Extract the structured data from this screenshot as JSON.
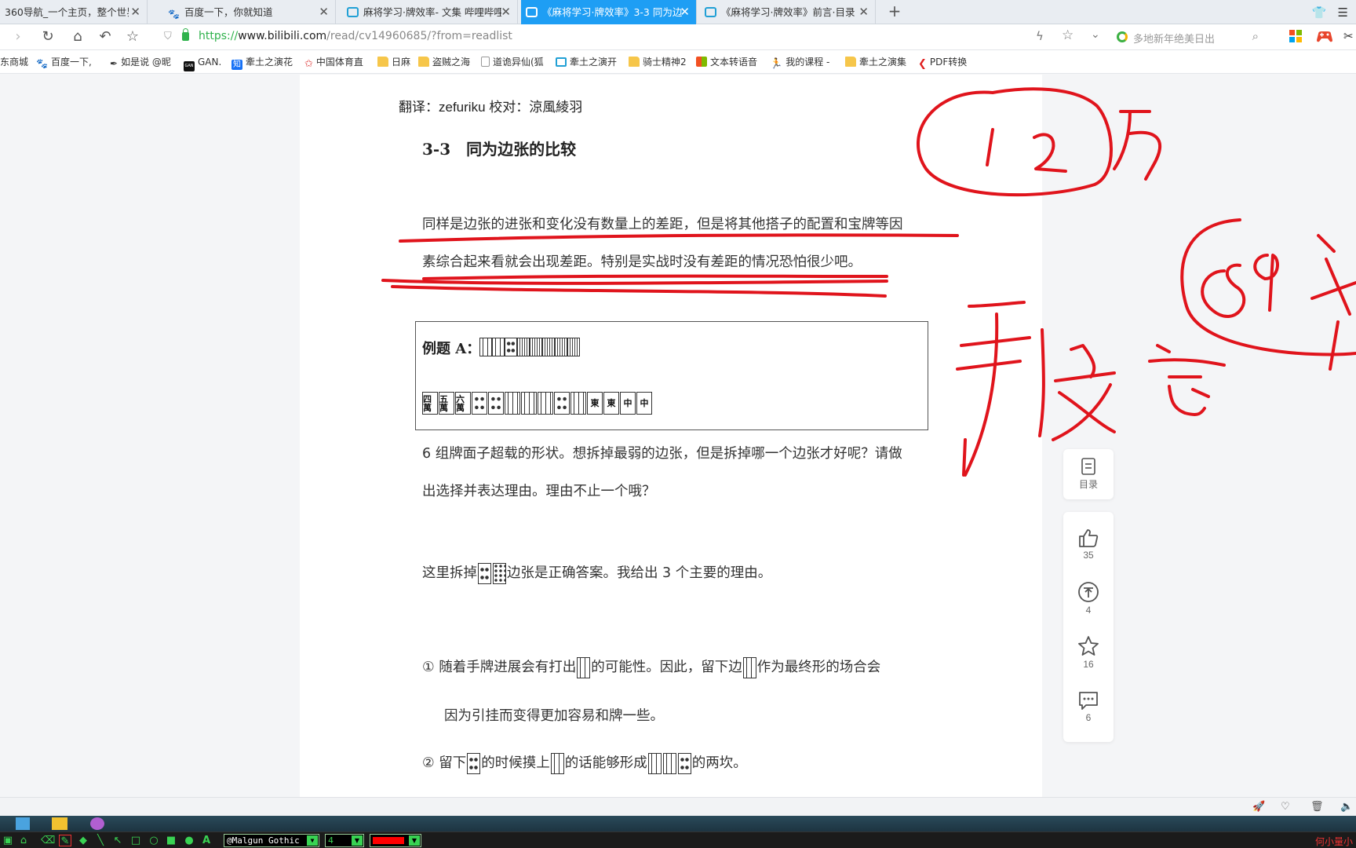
{
  "browser": {
    "tabs": [
      {
        "label": "360导航_一个主页，整个世界",
        "icon": "globe-icon"
      },
      {
        "label": "百度一下，你就知道",
        "icon": "baidu-paw-icon"
      },
      {
        "label": "麻将学习·牌效率- 文集 哔哩哔哩",
        "icon": "bilibili-tv-icon"
      },
      {
        "label": "《麻将学习·牌效率》3-3 同为边",
        "icon": "bilibili-tv-icon"
      },
      {
        "label": "《麻将学习·牌效率》前言·目录",
        "icon": "bilibili-tv-icon"
      }
    ],
    "active_tab": 3,
    "new_tab": "+",
    "url": {
      "protocol": "https://",
      "host": "www.bilibili.com",
      "path": "/read/cv14960685/?from=readlist"
    },
    "search_placeholder": "多地新年绝美日出",
    "accent_color": "#1e9ef4"
  },
  "bookmarks": [
    {
      "label": "东商城",
      "icon": "none"
    },
    {
      "label": "百度一下,",
      "icon": "baidu-paw-icon"
    },
    {
      "label": "如是说 @昵",
      "icon": "feather-icon"
    },
    {
      "label": "GAN.",
      "icon": "gan-logo-icon"
    },
    {
      "label": "牽土之演花",
      "icon": "zhihu-icon"
    },
    {
      "label": "中国体育直",
      "icon": "star-logo-icon"
    },
    {
      "label": "日麻",
      "icon": "folder-icon"
    },
    {
      "label": "盗贼之海",
      "icon": "folder-icon"
    },
    {
      "label": "道诡异仙(狐",
      "icon": "document-icon"
    },
    {
      "label": "牽土之演开",
      "icon": "bilibili-tv-icon"
    },
    {
      "label": "骑士精神2",
      "icon": "folder-icon"
    },
    {
      "label": "文本转语音",
      "icon": "microsoft-icon"
    },
    {
      "label": "我的课程 -",
      "icon": "runner-icon"
    },
    {
      "label": "牽土之演集",
      "icon": "folder-icon"
    },
    {
      "label": "PDF转换",
      "icon": "pdf-icon"
    }
  ],
  "article": {
    "translator_line": "翻译：zefuriku  校对：涼風綾羽",
    "heading": "3-3　同为边张的比较",
    "para1_line1": "同样是边张的进张和变化没有数量上的差距，但是将其他搭子的配置和宝牌等因",
    "para1_line2": "素综合起来看就会出现差距。特别是实战时没有差距的情况恐怕很少吧。",
    "example_label": "例题 A：",
    "hand_tiles": [
      "四萬",
      "五萬",
      "六萬",
      "pin",
      "pin",
      "sou",
      "sou",
      "sou",
      "pin",
      "sou",
      "東",
      "東",
      "中",
      "中"
    ],
    "para2_line1": "6 组牌面子超载的形状。想拆掉最弱的边张，但是拆掉哪一个边张才好呢？请做",
    "para2_line2": "出选择并表达理由。理由不止一个哦？",
    "answer_pre": "这里拆掉",
    "answer_post": "边张是正确答案。我给出 3 个主要的理由。",
    "reason1_num": "①",
    "reason1_a": "随着手牌进展会有打出",
    "reason1_b": "的可能性。因此，留下边",
    "reason1_c": "作为最终形的场合会",
    "reason1_line2": "因为引挂而变得更加容易和牌一些。",
    "reason2_num": "②",
    "reason2_a": "留下",
    "reason2_b": "的时候摸上",
    "reason2_c": "的话能够形成",
    "reason2_d": "的两坎。"
  },
  "sidebar": {
    "toc_label": "目录",
    "like_count": "35",
    "coin_count": "4",
    "fav_count": "16",
    "comment_count": "6"
  },
  "drawing_toolbar": {
    "font": "@Malgun Gothic",
    "size": "4",
    "pen_color": "#ff0000",
    "user": "何小量小"
  },
  "annotation": {
    "ink_color": "#e0141c"
  }
}
